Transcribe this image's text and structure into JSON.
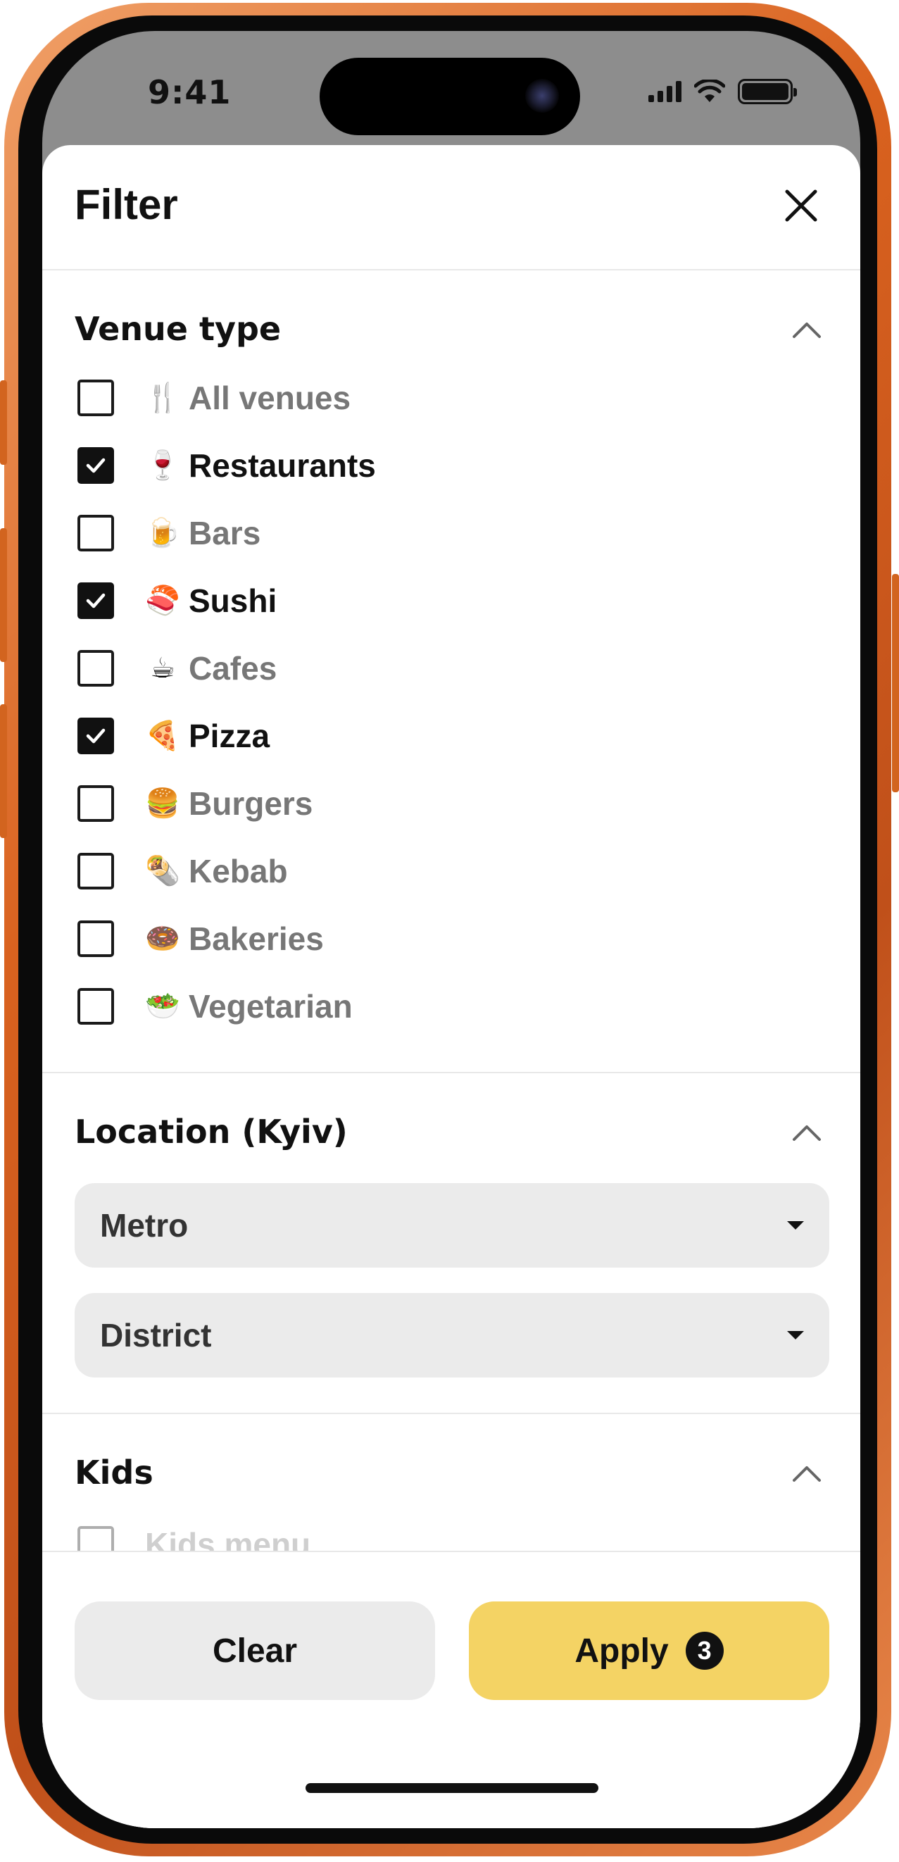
{
  "status": {
    "time": "9:41"
  },
  "sheet": {
    "title": "Filter",
    "venue_section": {
      "title": "Venue type",
      "options": [
        {
          "emoji": "🍴",
          "label": "All venues",
          "checked": false
        },
        {
          "emoji": "🍷",
          "label": "Restaurants",
          "checked": true
        },
        {
          "emoji": "🍺",
          "label": "Bars",
          "checked": false
        },
        {
          "emoji": "🍣",
          "label": "Sushi",
          "checked": true
        },
        {
          "emoji": "☕",
          "label": "Cafes",
          "checked": false
        },
        {
          "emoji": "🍕",
          "label": "Pizza",
          "checked": true
        },
        {
          "emoji": "🍔",
          "label": "Burgers",
          "checked": false
        },
        {
          "emoji": "🌯",
          "label": "Kebab",
          "checked": false
        },
        {
          "emoji": "🍩",
          "label": "Bakeries",
          "checked": false
        },
        {
          "emoji": "🥗",
          "label": "Vegetarian",
          "checked": false
        }
      ]
    },
    "location_section": {
      "title": "Location (Kyiv)",
      "metro_label": "Metro",
      "district_label": "District"
    },
    "kids_section": {
      "title": "Kids",
      "options": [
        {
          "label": "Kids menu",
          "checked": false
        }
      ]
    },
    "footer": {
      "clear_label": "Clear",
      "apply_label": "Apply",
      "apply_count": "3"
    }
  },
  "colors": {
    "apply_button": "#f4d364",
    "clear_button": "#ebebeb",
    "frame": "#d9621f"
  }
}
